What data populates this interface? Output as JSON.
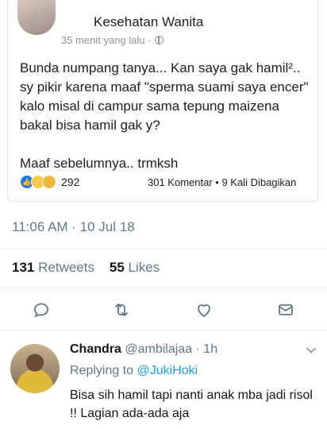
{
  "fb_post": {
    "page_name": "Kesehatan Wanita",
    "time": "35 menit yang lalu ·",
    "body": [
      "Bunda numpang tanya... Kan saya gak hamil².. sy pikir karena maaf \"sperma suami saya encer\" kalo misal di campur sama tepung maizena bakal bisa hamil gak y?",
      "Maaf sebelumnya.. trmksh"
    ],
    "reaction_count": "292",
    "stats": "301 Komentar • 9 Kali Dibagikan"
  },
  "tweet": {
    "timestamp": "11:06 AM · 10 Jul 18",
    "retweets_count": "131",
    "retweets_label": "Retweets",
    "likes_count": "55",
    "likes_label": "Likes"
  },
  "reply": {
    "name": "Chandra",
    "handle_time": "@ambilajaa · 1h",
    "replying_prefix": "Replying to",
    "replying_to": "@JukiHoki",
    "text": "Bisa sih hamil tapi nanti anak mba jadi risol !! Lagian ada-ada aja"
  },
  "icons": [
    "reply-icon",
    "retweet-icon",
    "like-icon",
    "share-icon",
    "chevron-down-icon",
    "globe-icon"
  ],
  "colors": {
    "accent": "#1da1f2",
    "secondary_text": "#657786",
    "fb_like": "#2078f4"
  }
}
